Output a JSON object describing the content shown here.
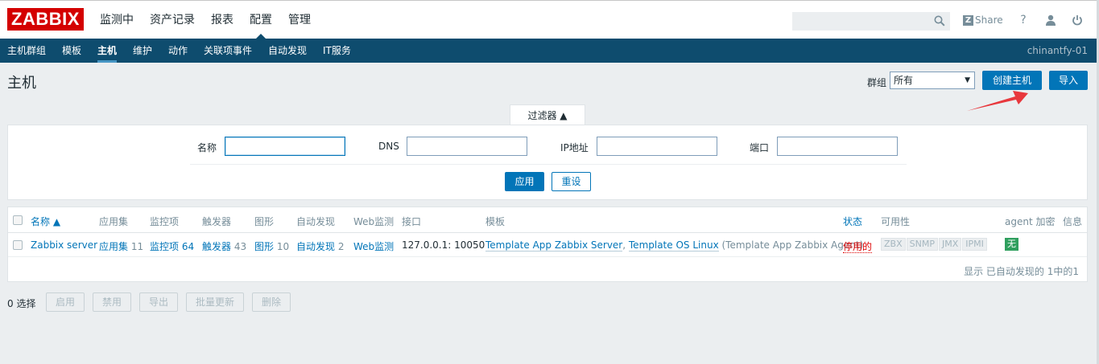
{
  "header": {
    "logo": "ZABBIX",
    "menu": [
      "监测中",
      "资产记录",
      "报表",
      "配置",
      "管理"
    ],
    "active_menu": "配置",
    "search_placeholder": "",
    "share_label": "Share",
    "help_label": "?",
    "icons": [
      "search-icon",
      "user-icon",
      "power-icon"
    ]
  },
  "subnav": {
    "items": [
      "主机群组",
      "模板",
      "主机",
      "维护",
      "动作",
      "关联项事件",
      "自动发现",
      "IT服务"
    ],
    "active": "主机",
    "host_label": "chinantfy-01"
  },
  "page": {
    "title": "主机",
    "group_label": "群组",
    "group_value": "所有",
    "create_button": "创建主机",
    "import_button": "导入"
  },
  "filter": {
    "tab_label": "过滤器 ▲",
    "name_label": "名称",
    "dns_label": "DNS",
    "ip_label": "IP地址",
    "port_label": "端口",
    "name_value": "",
    "dns_value": "",
    "ip_value": "",
    "port_value": "",
    "apply_button": "应用",
    "reset_button": "重设"
  },
  "table": {
    "headers": {
      "name": "名称 ▲",
      "apps": "应用集",
      "items": "监控项",
      "triggers": "触发器",
      "graphs": "图形",
      "discovery": "自动发现",
      "web": "Web监测",
      "interface": "接口",
      "templates": "模板",
      "status": "状态",
      "availability": "可用性",
      "encryption": "agent 加密",
      "info": "信息"
    },
    "row": {
      "name": "Zabbix server",
      "apps_label": "应用集",
      "apps_count": "11",
      "items_label": "监控项",
      "items_count": "64",
      "triggers_label": "触发器",
      "triggers_count": "43",
      "graphs_label": "图形",
      "graphs_count": "10",
      "discovery_label": "自动发现",
      "discovery_count": "2",
      "web_label": "Web监测",
      "interface": "127.0.0.1: 10050",
      "template_1": "Template App Zabbix Server",
      "template_sep": ", ",
      "template_2": "Template OS Linux",
      "template_paren_open": " (",
      "template_3": "Template App Zabbix Agent",
      "template_paren_close": ")",
      "status": "停用的",
      "availability": [
        "ZBX",
        "SNMP",
        "JMX",
        "IPMI"
      ],
      "encryption": "无"
    },
    "footer": "显示 已自动发现的 1中的1"
  },
  "actions": {
    "selected": "0 选择",
    "buttons": [
      "启用",
      "禁用",
      "导出",
      "批量更新",
      "删除"
    ]
  },
  "colors": {
    "brand_red": "#d40000",
    "nav_blue": "#0e4c6e",
    "link_blue": "#0275b8",
    "status_red": "#dc0000",
    "encryption_green": "#2f9f5e",
    "arrow_red": "#e8383d"
  }
}
